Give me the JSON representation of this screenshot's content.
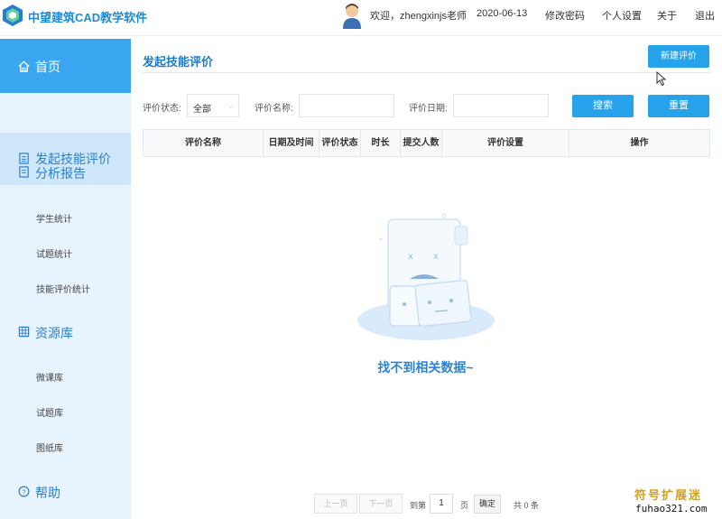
{
  "header": {
    "app_title": "中望建筑CAD教学软件",
    "greeting": "欢迎，zhengxinjs老师",
    "date": "2020-06-13",
    "links": [
      "修改密码",
      "个人设置",
      "关于",
      "退出"
    ]
  },
  "sidebar": {
    "items": [
      {
        "label": "首页",
        "icon": "home-icon",
        "level": "main"
      },
      {
        "label": "发起技能评价",
        "icon": "document-icon",
        "level": "main"
      },
      {
        "label": "分析报告",
        "icon": "report-icon",
        "level": "main"
      },
      {
        "label": "学生统计",
        "level": "sub"
      },
      {
        "label": "试题统计",
        "level": "sub"
      },
      {
        "label": "技能评价统计",
        "level": "sub"
      },
      {
        "label": "资源库",
        "icon": "grid-icon",
        "level": "main"
      },
      {
        "label": "微课库",
        "level": "sub"
      },
      {
        "label": "试题库",
        "level": "sub"
      },
      {
        "label": "图纸库",
        "level": "sub"
      },
      {
        "label": "帮助",
        "icon": "help-icon",
        "level": "main"
      }
    ]
  },
  "main": {
    "page_title": "发起技能评价",
    "new_button": "新建评价",
    "filters": {
      "status_label": "评价状态:",
      "status_value": "全部",
      "name_label": "评价名称:",
      "date_label": "评价日期:",
      "search_button": "搜索",
      "reset_button": "重置"
    },
    "table": {
      "columns": [
        "评价名称",
        "日期及时间",
        "评价状态",
        "时长",
        "提交人数",
        "评价设置",
        "操作"
      ]
    },
    "empty_text": "找不到相关数据~"
  },
  "pagination": {
    "prev": "上一页",
    "next": "下一页",
    "goto": "到第",
    "page": "1",
    "page_unit": "页",
    "confirm": "确定",
    "total": "共 0 条"
  },
  "watermark": {
    "cn": "符号扩展迷",
    "en": "fuhao321.com"
  },
  "colors": {
    "accent": "#27a3ec",
    "sidebar_bg": "#e8f4fd",
    "sidebar_active": "#3aa6f0"
  }
}
